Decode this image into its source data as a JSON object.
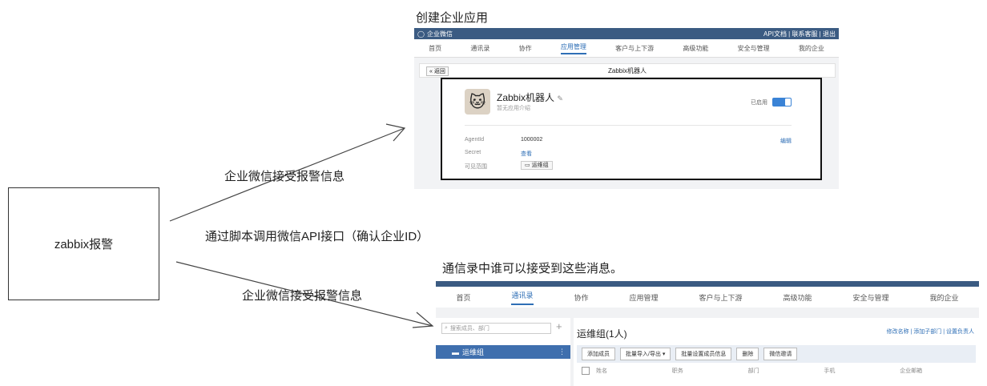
{
  "diagram": {
    "source_label": "zabbix报警",
    "arrow_label_top": "企业微信接受报警信息",
    "arrow_label_middle": "通过脚本调用微信API接口（确认企业ID）",
    "arrow_label_bottom": "企业微信接受报警信息",
    "caption_top": "创建企业应用",
    "caption_bottom": "通信录中谁可以接受到这些消息。"
  },
  "app_screenshot": {
    "brand": "企业微信",
    "top_links": "API文档 | 联系客服 | 退出",
    "nav": [
      "首页",
      "通讯录",
      "协作",
      "应用管理",
      "客户与上下游",
      "高级功能",
      "安全与管理",
      "我的企业"
    ],
    "active_nav": 3,
    "back_label": "« 返回",
    "page_title": "Zabbix机器人",
    "bot_name": "Zabbix机器人",
    "bot_desc": "暂无应用介绍",
    "enabled_label": "已启用",
    "agentid_label": "AgentId",
    "agentid_value": "1000002",
    "secret_label": "Secret",
    "secret_value": "查看",
    "visible_label": "可见范围",
    "visible_value": "运维组",
    "edit_label": "编辑"
  },
  "contacts_screenshot": {
    "nav": [
      "首页",
      "通讯录",
      "协作",
      "应用管理",
      "客户与上下游",
      "高级功能",
      "安全与管理",
      "我的企业"
    ],
    "active_nav": 1,
    "search_placeholder": "搜索成员、部门",
    "group_name": "运维组",
    "group_title": "运维组(1人)",
    "group_links": "修改名称 | 添加子部门 | 设置负责人",
    "buttons": [
      "添加成员",
      "批量导入/导出 ▾",
      "批量设置成员信息",
      "删除",
      "微信邀请"
    ],
    "columns": [
      "姓名",
      "职务",
      "部门",
      "手机",
      "企业邮箱"
    ]
  }
}
